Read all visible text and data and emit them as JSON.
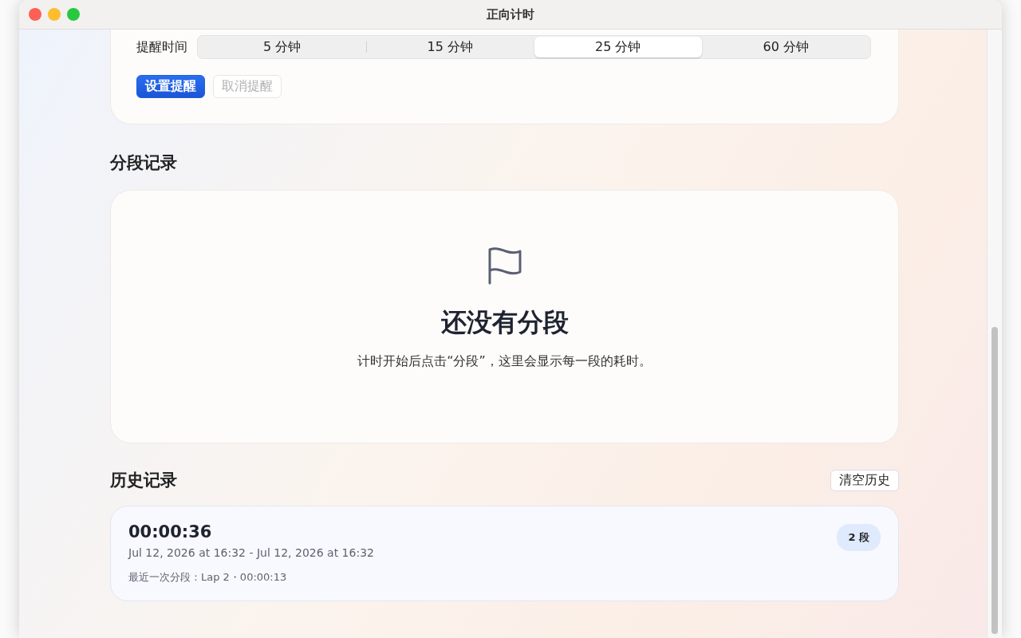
{
  "window": {
    "title": "正向计时"
  },
  "reminder": {
    "label": "提醒时间",
    "options": [
      {
        "label": "5 分钟",
        "selected": false
      },
      {
        "label": "15 分钟",
        "selected": false
      },
      {
        "label": "25 分钟",
        "selected": true
      },
      {
        "label": "60 分钟",
        "selected": false
      }
    ],
    "buttons": [
      {
        "label": "设置提醒",
        "kind": "primary",
        "disabled": false
      },
      {
        "label": "取消提醒",
        "kind": "secondary",
        "disabled": true
      }
    ]
  },
  "laps": {
    "title": "分段记录",
    "empty_title": "还没有分段",
    "empty_text": "计时开始后点击“分段”，这里会显示每一段的耗时。"
  },
  "history": {
    "title": "历史记录",
    "clear_button": "清空历史",
    "items": [
      {
        "duration": "00:00:36",
        "range": "Jul 12, 2026 at 16:32 - Jul 12, 2026 at 16:32",
        "last_lap": "最近一次分段：Lap 2・00:00:13",
        "badge": "2 段"
      }
    ]
  }
}
